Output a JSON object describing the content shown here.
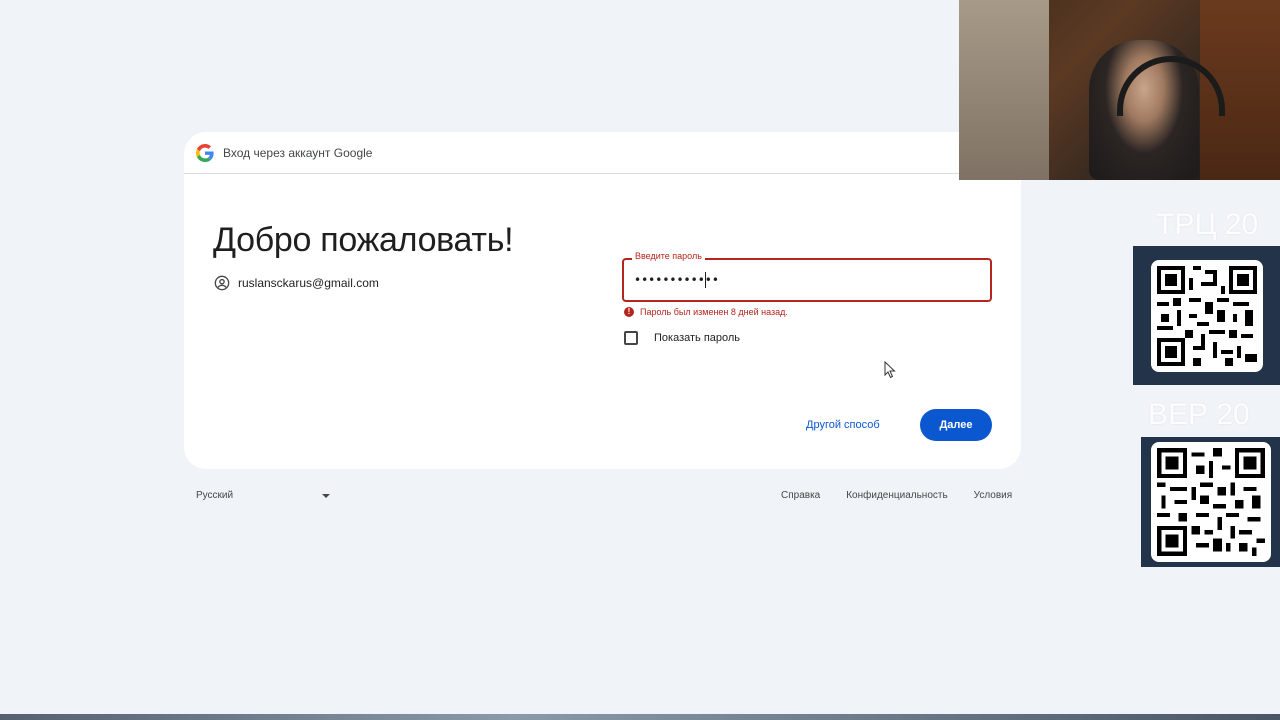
{
  "header": {
    "title": "Вход через аккаунт Google"
  },
  "main": {
    "title": "Добро пожаловать!",
    "account_email": "ruslansckarus@gmail.com"
  },
  "password": {
    "label": "Введите пароль",
    "value": "••••••••••••",
    "error": "Пароль был изменен 8 дней назад.",
    "show_password_label": "Показать пароль"
  },
  "actions": {
    "other_way": "Другой способ",
    "next": "Далее"
  },
  "footer": {
    "language": "Русский",
    "help": "Справка",
    "privacy": "Конфиденциальность",
    "terms": "Условия"
  },
  "overlay": {
    "qr1_label": "ТРЦ 20",
    "qr2_label": "ВЕР 20"
  },
  "colors": {
    "accent": "#0b57d0",
    "error": "#b3261e",
    "background": "#f0f4f9"
  }
}
